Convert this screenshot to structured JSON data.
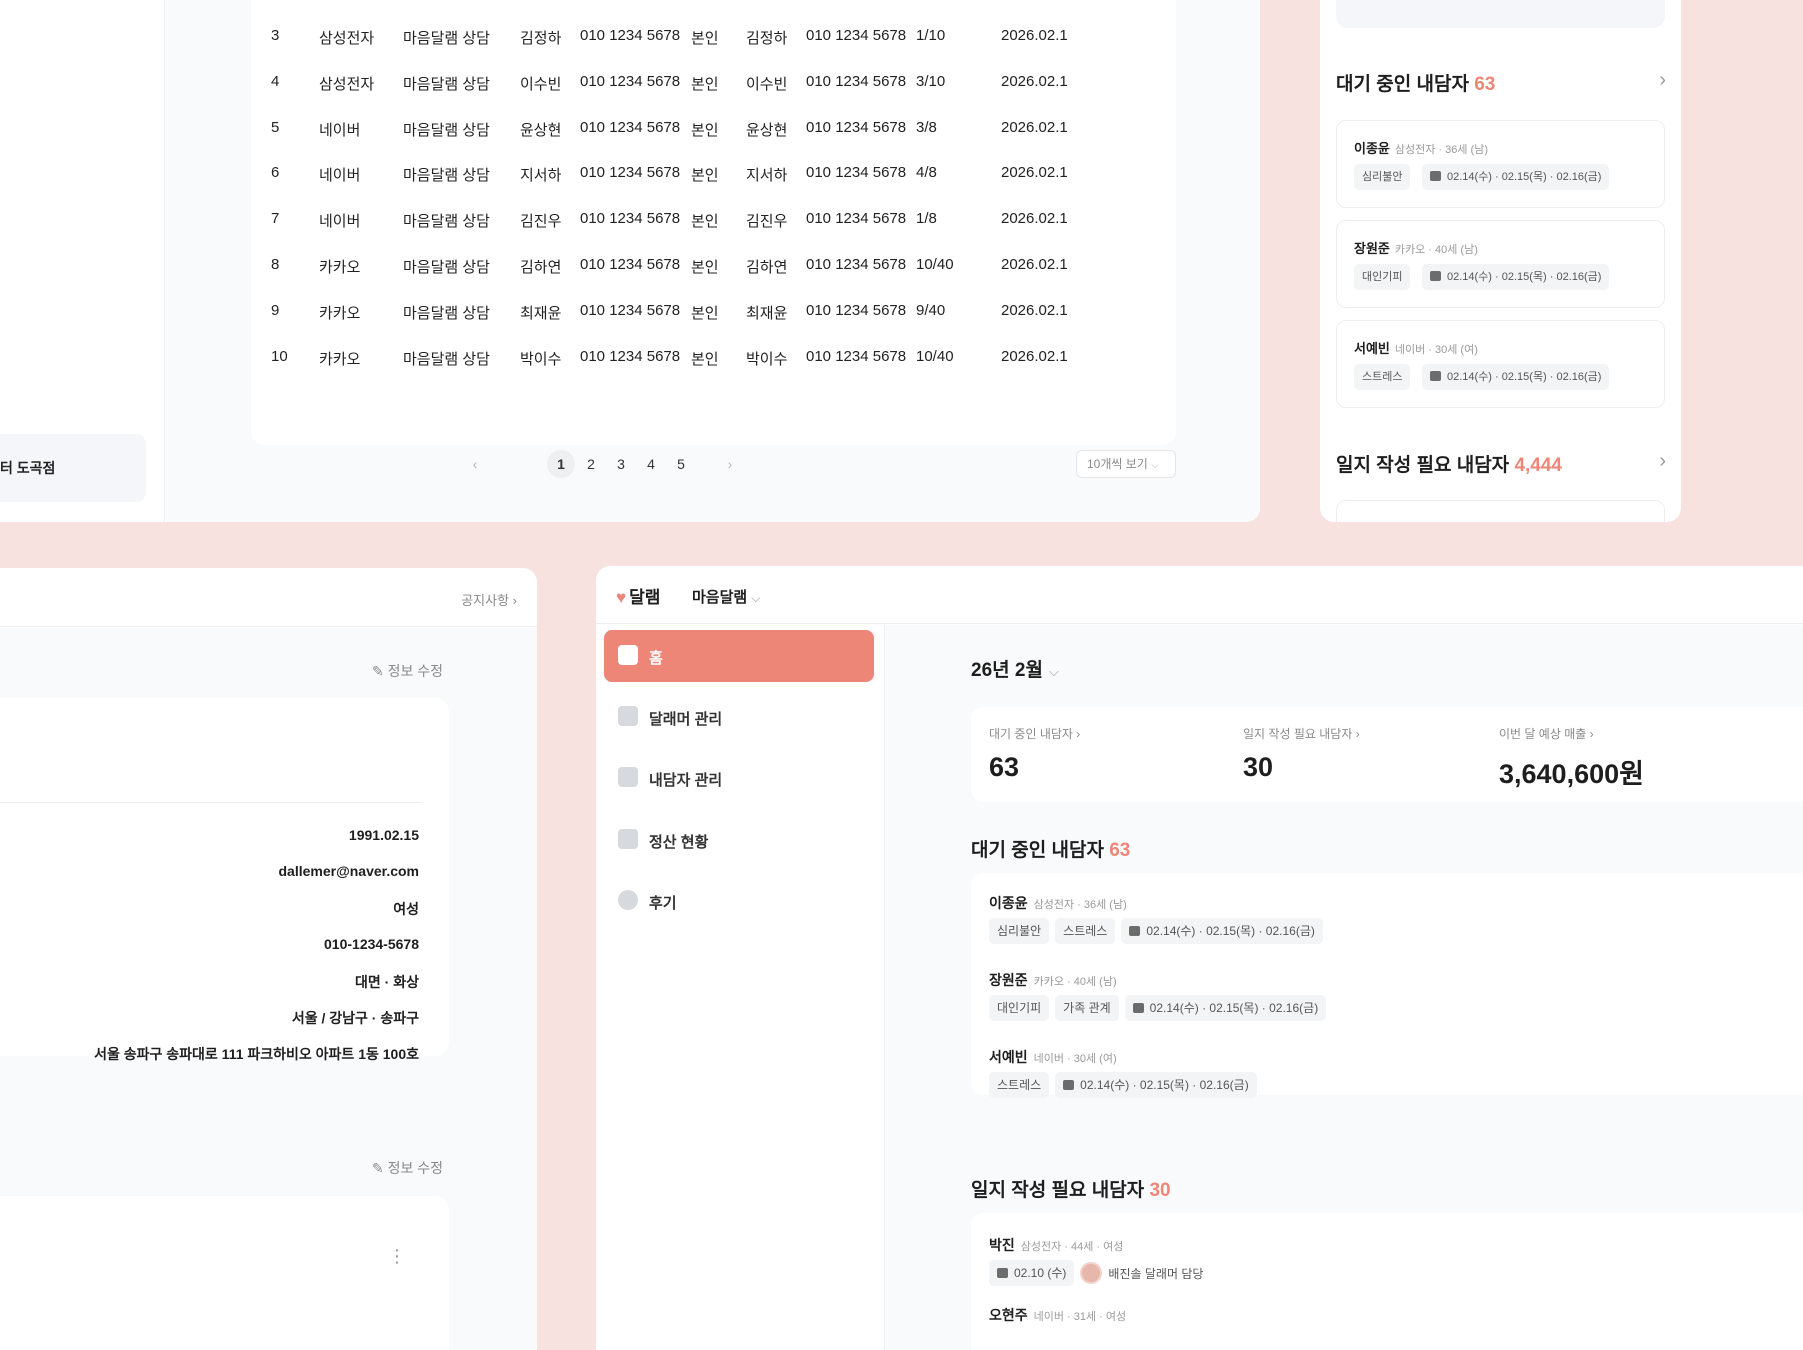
{
  "table": {
    "rows": [
      {
        "no": "3",
        "company": "삼성전자",
        "program": "마음달램 상담",
        "applicant": "김정하",
        "applicant_phone": "010 1234 5678",
        "relation": "본인",
        "client": "김정하",
        "client_phone": "010 1234 5678",
        "sessions": "1/10",
        "date": "2026.02.1"
      },
      {
        "no": "4",
        "company": "삼성전자",
        "program": "마음달램 상담",
        "applicant": "이수빈",
        "applicant_phone": "010 1234 5678",
        "relation": "본인",
        "client": "이수빈",
        "client_phone": "010 1234 5678",
        "sessions": "3/10",
        "date": "2026.02.1"
      },
      {
        "no": "5",
        "company": "네이버",
        "program": "마음달램 상담",
        "applicant": "윤상현",
        "applicant_phone": "010 1234 5678",
        "relation": "본인",
        "client": "윤상현",
        "client_phone": "010 1234 5678",
        "sessions": "3/8",
        "date": "2026.02.1"
      },
      {
        "no": "6",
        "company": "네이버",
        "program": "마음달램 상담",
        "applicant": "지서하",
        "applicant_phone": "010 1234 5678",
        "relation": "본인",
        "client": "지서하",
        "client_phone": "010 1234 5678",
        "sessions": "4/8",
        "date": "2026.02.1"
      },
      {
        "no": "7",
        "company": "네이버",
        "program": "마음달램 상담",
        "applicant": "김진우",
        "applicant_phone": "010 1234 5678",
        "relation": "본인",
        "client": "김진우",
        "client_phone": "010 1234 5678",
        "sessions": "1/8",
        "date": "2026.02.1"
      },
      {
        "no": "8",
        "company": "카카오",
        "program": "마음달램 상담",
        "applicant": "김하연",
        "applicant_phone": "010 1234 5678",
        "relation": "본인",
        "client": "김하연",
        "client_phone": "010 1234 5678",
        "sessions": "10/40",
        "date": "2026.02.1"
      },
      {
        "no": "9",
        "company": "카카오",
        "program": "마음달램 상담",
        "applicant": "최재윤",
        "applicant_phone": "010 1234 5678",
        "relation": "본인",
        "client": "최재윤",
        "client_phone": "010 1234 5678",
        "sessions": "9/40",
        "date": "2026.02.1"
      },
      {
        "no": "10",
        "company": "카카오",
        "program": "마음달램 상담",
        "applicant": "박이수",
        "applicant_phone": "010 1234 5678",
        "relation": "본인",
        "client": "박이수",
        "client_phone": "010 1234 5678",
        "sessions": "10/40",
        "date": "2026.02.1"
      }
    ],
    "pagination": {
      "prev": "‹",
      "next": "›",
      "pages": [
        "1",
        "2",
        "3",
        "4",
        "5"
      ],
      "current": "1",
      "page_size": "10개씩 보기"
    },
    "side_item": "터 도곡점"
  },
  "right_card": {
    "waiting": {
      "title": "대기 중인 내담자",
      "count": "63",
      "chevron": "›"
    },
    "clients": [
      {
        "name": "이종윤",
        "meta": "삼성전자 · 36세 (남)",
        "tags": [
          "심리불안"
        ],
        "dates": "02.14(수) · 02.15(목) · 02.16(금)"
      },
      {
        "name": "장원준",
        "meta": "카카오 · 40세 (남)",
        "tags": [
          "대인기피"
        ],
        "dates": "02.14(수) · 02.15(목) · 02.16(금)"
      },
      {
        "name": "서예빈",
        "meta": "네이버 · 30세 (여)",
        "tags": [
          "스트레스"
        ],
        "dates": "02.14(수) · 02.15(목) · 02.16(금)"
      }
    ],
    "journal": {
      "title": "일지 작성 필요 내담자",
      "count": "4,444",
      "chevron": "›"
    }
  },
  "profile": {
    "notice": "공지사항 ›",
    "edit_label_1": "✎ 정보 수정",
    "edit_label_2": "✎ 정보 수정",
    "more": "⋮",
    "fields": [
      "1991.02.15",
      "dallemer@naver.com",
      "여성",
      "010-1234-5678",
      "대면 · 화상",
      "서울 / 강남구 · 송파구",
      "서울 송파구 송파대로 111 파크하비오 아파트 1동 100호"
    ]
  },
  "dashboard": {
    "logo": "달램",
    "org": "마음달램",
    "nav": [
      {
        "label": "홈",
        "icon": "home-icon",
        "active": true
      },
      {
        "label": "달래머 관리",
        "icon": "counselor-icon",
        "active": false
      },
      {
        "label": "내담자 관리",
        "icon": "clients-icon",
        "active": false
      },
      {
        "label": "정산 현황",
        "icon": "receipt-icon",
        "active": false
      },
      {
        "label": "후기",
        "icon": "review-icon",
        "active": false
      }
    ],
    "month": "26년 2월",
    "stats": [
      {
        "label": "대기 중인 내담자 ›",
        "value": "63"
      },
      {
        "label": "일지 작성 필요 내담자 ›",
        "value": "30"
      },
      {
        "label": "이번 달 예상 매출 ›",
        "value": "3,640,600원"
      }
    ],
    "waiting": {
      "title": "대기 중인 내담자",
      "count": "63",
      "clients": [
        {
          "name": "이종윤",
          "meta": "삼성전자 · 36세 (남)",
          "tags": [
            "심리불안",
            "스트레스"
          ],
          "dates": "02.14(수) · 02.15(목) · 02.16(금)"
        },
        {
          "name": "장원준",
          "meta": "카카오 · 40세 (남)",
          "tags": [
            "대인기피",
            "가족 관계"
          ],
          "dates": "02.14(수) · 02.15(목) · 02.16(금)"
        },
        {
          "name": "서예빈",
          "meta": "네이버 · 30세 (여)",
          "tags": [
            "스트레스"
          ],
          "dates": "02.14(수) · 02.15(목) · 02.16(금)"
        }
      ]
    },
    "journal": {
      "title": "일지 작성 필요 내담자",
      "count": "30",
      "clients": [
        {
          "name": "박진",
          "meta": "삼성전자 · 44세 · 여성",
          "date": "02.10 (수)",
          "assignee": "배진솔 달래머 담당"
        },
        {
          "name": "오현주",
          "meta": "네이버 · 31세 · 여성"
        }
      ]
    }
  },
  "colors": {
    "accent": "#ee8678",
    "background": "#f7e2df"
  }
}
